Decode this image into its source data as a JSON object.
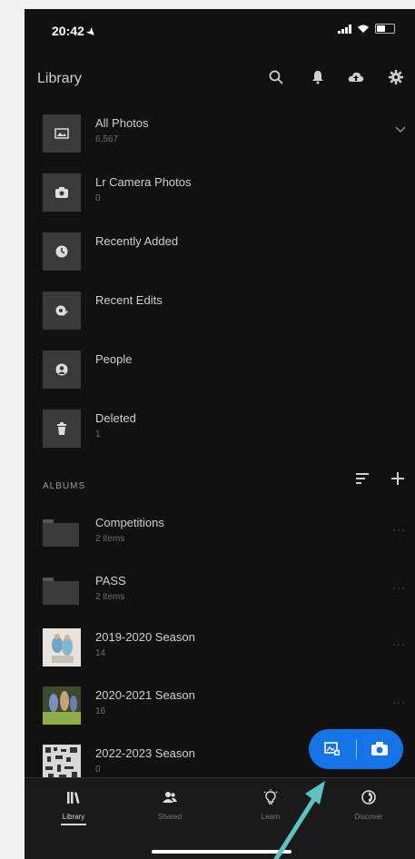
{
  "status_bar": {
    "time": "20:42"
  },
  "header": {
    "title": "Library",
    "icons": [
      "search-icon",
      "bell-icon",
      "cloud-icon",
      "gear-icon"
    ]
  },
  "library_items": [
    {
      "label": "All Photos",
      "sub": "6,567",
      "icon": "photo-icon"
    },
    {
      "label": "Lr Camera Photos",
      "sub": "0",
      "icon": "camera-icon"
    },
    {
      "label": "Recently Added",
      "sub": "",
      "icon": "clock-icon"
    },
    {
      "label": "Recent Edits",
      "sub": "",
      "icon": "edit-icon"
    },
    {
      "label": "People",
      "sub": "",
      "icon": "person-icon"
    },
    {
      "label": "Deleted",
      "sub": "1",
      "icon": "trash-icon"
    }
  ],
  "albums": {
    "section_label": "ALBUMS",
    "items": [
      {
        "label": "Competitions",
        "sub": "2 items",
        "type": "folder"
      },
      {
        "label": "PASS",
        "sub": "2 items",
        "type": "folder"
      },
      {
        "label": "2019-2020 Season",
        "sub": "14",
        "type": "photo"
      },
      {
        "label": "2020-2021 Season",
        "sub": "16",
        "type": "photo"
      },
      {
        "label": "2022-2023 Season",
        "sub": "0",
        "type": "photo"
      }
    ],
    "more_label": "···"
  },
  "tabs": [
    {
      "label": "Library",
      "icon": "library-icon",
      "active": true
    },
    {
      "label": "Shared",
      "icon": "people-icon",
      "active": false
    },
    {
      "label": "Learn",
      "icon": "lightbulb-icon",
      "active": false
    },
    {
      "label": "Discover",
      "icon": "discover-icon",
      "active": false
    }
  ],
  "colors": {
    "background": "#111111",
    "accent": "#1473e6",
    "annotation_arrow": "#5cc4c0"
  }
}
